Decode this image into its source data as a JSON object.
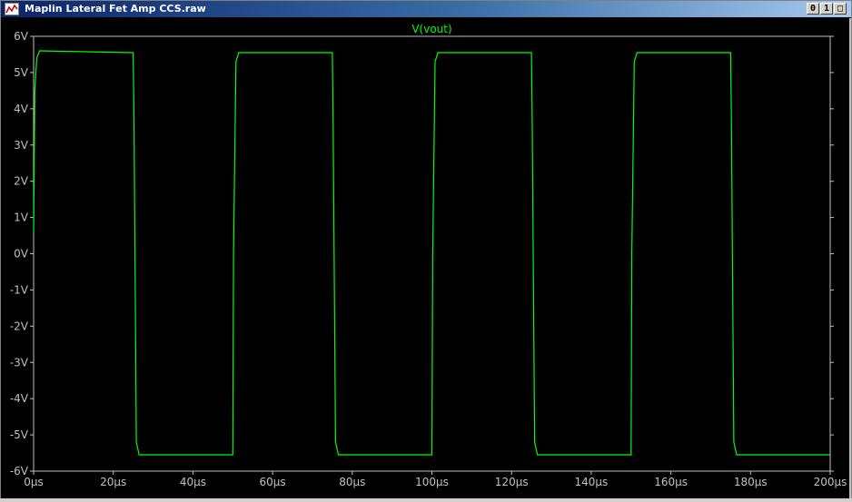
{
  "window": {
    "title": "Maplin Lateral Fet Amp CCS.raw",
    "buttons": [
      "0",
      "1",
      "□"
    ],
    "icon": "waveform-icon"
  },
  "colors": {
    "trace": "#00ff00",
    "axis": "#ffffff",
    "label": "#c0c0c0",
    "title": "#00ff00",
    "background": "#000000"
  },
  "chart_data": {
    "type": "line",
    "title": "V(vout)",
    "xlabel": "",
    "ylabel": "",
    "xlim": [
      0,
      200
    ],
    "ylim": [
      -6,
      6
    ],
    "x_ticks": [
      "0µs",
      "20µs",
      "40µs",
      "60µs",
      "80µs",
      "100µs",
      "120µs",
      "140µs",
      "160µs",
      "180µs",
      "200µs"
    ],
    "y_ticks": [
      "6V",
      "5V",
      "4V",
      "3V",
      "2V",
      "1V",
      "0V",
      "-1V",
      "-2V",
      "-3V",
      "-4V",
      "-5V",
      "-6V"
    ],
    "series": [
      {
        "name": "V(vout)",
        "x": [
          0,
          0.3,
          0.8,
          1.5,
          25,
          25.2,
          25.8,
          26.5,
          50,
          50.2,
          50.8,
          51.5,
          75,
          75.2,
          75.8,
          76.5,
          100,
          100.2,
          100.8,
          101.5,
          125,
          125.2,
          125.8,
          126.5,
          150,
          150.2,
          150.8,
          151.5,
          175,
          175.2,
          175.8,
          176.5,
          200
        ],
        "y": [
          0.6,
          4.5,
          5.4,
          5.6,
          5.55,
          3.8,
          -5.2,
          -5.55,
          -5.55,
          0.0,
          5.3,
          5.55,
          5.55,
          3.5,
          -5.2,
          -5.55,
          -5.55,
          0.0,
          5.3,
          5.55,
          5.55,
          3.5,
          -5.2,
          -5.55,
          -5.55,
          0.0,
          5.3,
          5.55,
          5.55,
          3.5,
          -5.2,
          -5.55,
          -5.55
        ]
      }
    ]
  }
}
